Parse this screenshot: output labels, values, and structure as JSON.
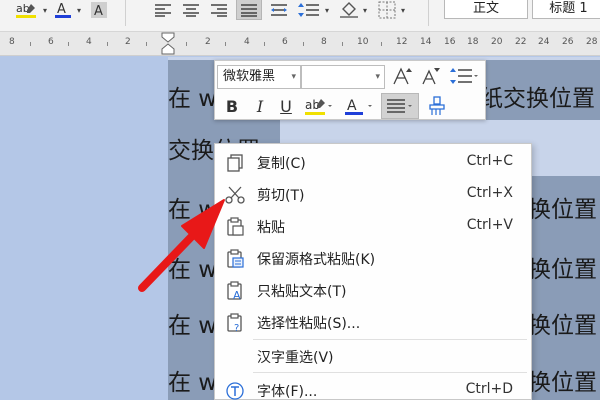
{
  "ribbon": {
    "font_color": "#1f3fd8",
    "highlight_color": "#f0e000",
    "styles": [
      "正文",
      "标题 1"
    ]
  },
  "ruler": {
    "numbers": [
      "8",
      "6",
      "4",
      "2",
      "2",
      "4",
      "6",
      "8",
      "10",
      "12",
      "14",
      "16",
      "18",
      "20",
      "22",
      "24",
      "26",
      "28"
    ]
  },
  "document": {
    "lines": [
      {
        "left": "在 w",
        "right": "纸交换位置"
      },
      {
        "left": "交换位置",
        "right": ""
      },
      {
        "left": "在 w",
        "right": "换位置"
      },
      {
        "left": "在 w",
        "right": "换位置"
      },
      {
        "left": "在 w",
        "right": "换位置"
      },
      {
        "left": "在 w",
        "right": "换位置"
      }
    ]
  },
  "mini_toolbar": {
    "font_name": "微软雅黑",
    "font_size": "",
    "buttons": [
      "A",
      "A",
      "B",
      "I",
      "U"
    ],
    "accent_underline": "#1f3fd8",
    "highlight_color": "#f0e000"
  },
  "context_menu": {
    "items": [
      {
        "icon": "copy-icon",
        "label": "复制(C)",
        "shortcut": "Ctrl+C"
      },
      {
        "icon": "scissors-icon",
        "label": "剪切(T)",
        "shortcut": "Ctrl+X"
      },
      {
        "icon": "paste-icon",
        "label": "粘贴",
        "shortcut": "Ctrl+V"
      },
      {
        "icon": "paste-keep-format-icon",
        "label": "保留源格式粘贴(K)",
        "shortcut": ""
      },
      {
        "icon": "paste-text-only-icon",
        "label": "只粘贴文本(T)",
        "shortcut": ""
      },
      {
        "icon": "paste-special-icon",
        "label": "选择性粘贴(S)...",
        "shortcut": ""
      },
      {
        "icon": "",
        "label": "汉字重选(V)",
        "shortcut": ""
      },
      {
        "icon": "font-icon",
        "label": "字体(F)...",
        "shortcut": "Ctrl+D"
      }
    ]
  },
  "annotation": {
    "arrow_color": "#e81818"
  }
}
